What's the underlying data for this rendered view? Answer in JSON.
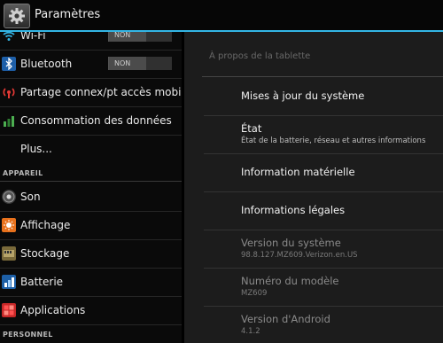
{
  "header": {
    "title": "Paramètres",
    "icon": "gear-icon",
    "accent": "#33b5e5"
  },
  "sidebar": {
    "items": [
      {
        "label": "Wi-Fi",
        "icon": "wifi-icon",
        "toggle": "NON"
      },
      {
        "label": "Bluetooth",
        "icon": "bluetooth-icon",
        "toggle": "NON"
      },
      {
        "label": "Partage connex/pt accès mobile",
        "icon": "tethering-icon"
      },
      {
        "label": "Consommation des données",
        "icon": "data-usage-icon"
      },
      {
        "label": "Plus..."
      }
    ],
    "section_device": "APPAREIL",
    "device_items": [
      {
        "label": "Son",
        "icon": "sound-icon"
      },
      {
        "label": "Affichage",
        "icon": "display-icon"
      },
      {
        "label": "Stockage",
        "icon": "storage-icon"
      },
      {
        "label": "Batterie",
        "icon": "battery-icon"
      },
      {
        "label": "Applications",
        "icon": "apps-icon"
      }
    ],
    "section_personal": "PERSONNEL"
  },
  "main": {
    "title": "À propos de la tablette",
    "items": [
      {
        "title": "Mises à jour du système"
      },
      {
        "title": "État",
        "subtitle": "État de la batterie, réseau et autres informations"
      },
      {
        "title": "Information matérielle"
      },
      {
        "title": "Informations légales"
      },
      {
        "title": "Version du système",
        "subtitle": "98.8.127.MZ609.Verizon.en.US"
      },
      {
        "title": "Numéro du modèle",
        "subtitle": "MZ609"
      },
      {
        "title": "Version d'Android",
        "subtitle": "4.1.2"
      }
    ]
  }
}
